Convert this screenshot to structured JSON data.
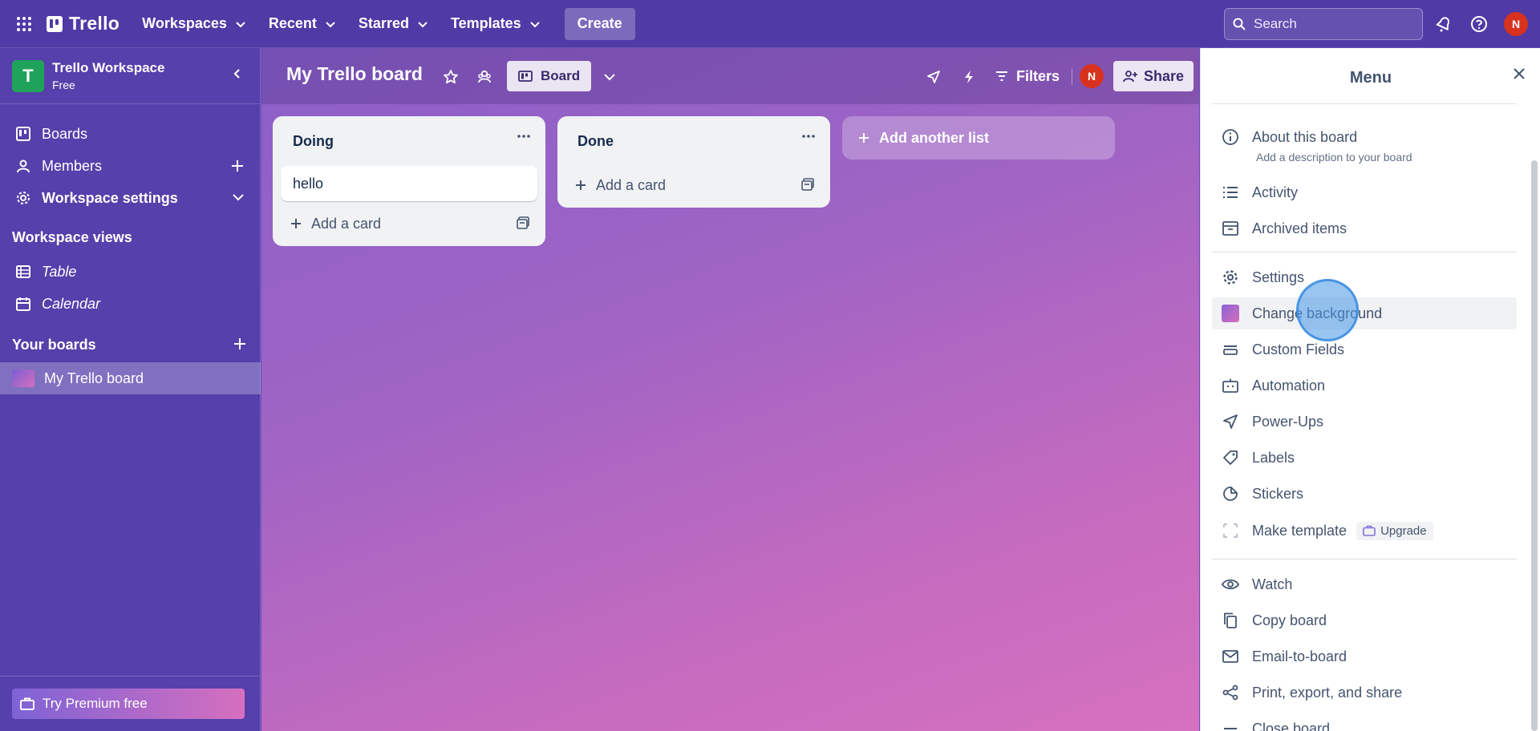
{
  "topbar": {
    "app_name": "Trello",
    "nav": [
      "Workspaces",
      "Recent",
      "Starred",
      "Templates"
    ],
    "create_label": "Create",
    "search_placeholder": "Search",
    "avatar_initial": "N"
  },
  "sidebar": {
    "workspace_name": "Trello Workspace",
    "workspace_plan": "Free",
    "workspace_initial": "T",
    "items": [
      {
        "label": "Boards",
        "icon": "trello-icon"
      },
      {
        "label": "Members",
        "icon": "person-icon"
      },
      {
        "label": "Workspace settings",
        "icon": "gear-icon"
      }
    ],
    "views_heading": "Workspace views",
    "views": [
      {
        "label": "Table",
        "icon": "table-icon"
      },
      {
        "label": "Calendar",
        "icon": "calendar-icon"
      }
    ],
    "boards_heading": "Your boards",
    "boards": [
      {
        "label": "My Trello board"
      }
    ],
    "premium_label": "Try Premium free"
  },
  "board": {
    "title": "My Trello board",
    "view_label": "Board",
    "filters_label": "Filters",
    "share_label": "Share",
    "avatar_initial": "N",
    "lists": [
      {
        "name": "Doing",
        "cards": [
          "hello"
        ],
        "add_card_label": "Add a card"
      },
      {
        "name": "Done",
        "cards": [],
        "add_card_label": "Add a card"
      }
    ],
    "add_list_label": "Add another list"
  },
  "menu": {
    "title": "Menu",
    "about_label": "About this board",
    "about_sub": "Add a description to your board",
    "activity": "Activity",
    "archived": "Archived items",
    "settings": "Settings",
    "change_background": "Change background",
    "custom_fields": "Custom Fields",
    "automation": "Automation",
    "power_ups": "Power-Ups",
    "labels": "Labels",
    "stickers": "Stickers",
    "make_template": "Make template",
    "upgrade": "Upgrade",
    "watch": "Watch",
    "copy_board": "Copy board",
    "email_to_board": "Email-to-board",
    "print_export": "Print, export, and share",
    "close_board": "Close board"
  },
  "colors": {
    "topbar": "#4f3aa6",
    "sidebar": "#5640ab",
    "workspace_badge": "#1fa35b",
    "avatar": "#d8321f",
    "list_bg": "#f1f2f4"
  }
}
